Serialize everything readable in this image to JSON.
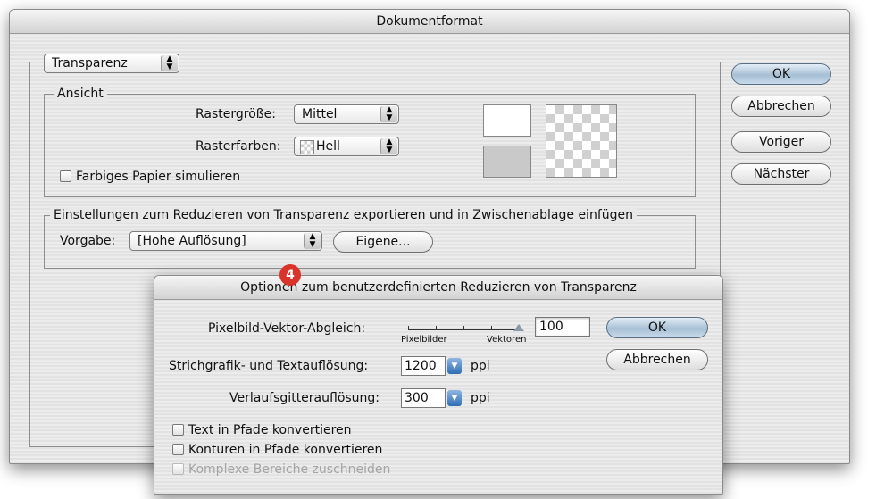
{
  "main_dialog": {
    "title": "Dokumentformat",
    "section_popup": "Transparenz",
    "ansicht": {
      "legend": "Ansicht",
      "raster_size_label": "Rastergröße:",
      "raster_size_value": "Mittel",
      "raster_colors_label": "Rasterfarben:",
      "raster_colors_value": "Hell",
      "simulate_paper_label": "Farbiges Papier simulieren",
      "simulate_paper_checked": false
    },
    "flatten": {
      "legend": "Einstellungen zum Reduzieren von Transparenz exportieren und in Zwischenablage einfügen",
      "preset_label": "Vorgabe:",
      "preset_value": "[Hohe Auflösung]",
      "custom_button": "Eigene..."
    },
    "buttons": {
      "ok": "OK",
      "cancel": "Abbrechen",
      "previous": "Voriger",
      "next": "Nächster"
    }
  },
  "step_badge": "4",
  "sub_dialog": {
    "title": "Optionen zum benutzerdefinierten Reduzieren von Transparenz",
    "raster_vector_label": "Pixelbild-Vektor-Abgleich:",
    "slider_min_label": "Pixelbilder",
    "slider_max_label": "Vektoren",
    "raster_vector_value": "100",
    "raster_vector_fraction": 1.0,
    "line_art_label": "Strichgrafik- und Textauflösung:",
    "line_art_value": "1200",
    "line_art_unit": "ppi",
    "gradient_label": "Verlaufsgitterauflösung:",
    "gradient_value": "300",
    "gradient_unit": "ppi",
    "checkboxes": [
      {
        "label": "Text in Pfade konvertieren",
        "checked": false,
        "enabled": true
      },
      {
        "label": "Konturen in Pfade konvertieren",
        "checked": false,
        "enabled": true
      },
      {
        "label": "Komplexe Bereiche zuschneiden",
        "checked": false,
        "enabled": false
      }
    ],
    "ok_button": "OK",
    "cancel_button": "Abbrechen"
  },
  "colors": {
    "badge": "#d9342b",
    "default_button": "#a7bfd4",
    "combo_arrow": "#2f6db5"
  }
}
